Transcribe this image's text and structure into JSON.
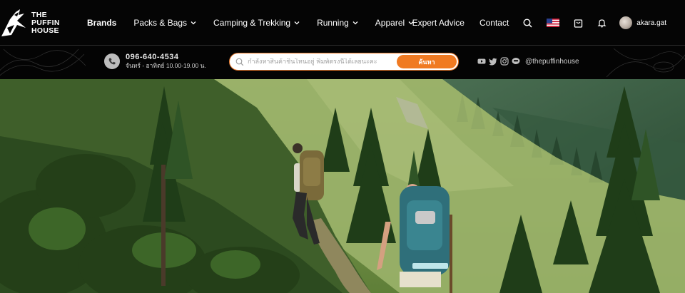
{
  "brand": {
    "line1": "THE",
    "line2": "PUFFIN",
    "line3": "HOUSE"
  },
  "nav": {
    "items": [
      {
        "label": "Brands",
        "dropdown": false
      },
      {
        "label": "Packs & Bags",
        "dropdown": true
      },
      {
        "label": "Camping & Trekking",
        "dropdown": true
      },
      {
        "label": "Running",
        "dropdown": true
      },
      {
        "label": "Apparel",
        "dropdown": true
      }
    ],
    "expert_advice": "Expert Advice",
    "contact": "Contact",
    "icons": [
      "search-icon",
      "us-flag-icon",
      "bag-icon",
      "bell-icon"
    ],
    "username": "akara.gat"
  },
  "contact_bar": {
    "phone": "096-640-4534",
    "hours": "จันทร์ - อาทิตย์ 10.00-19.00 น.",
    "search_placeholder": "กำลังหาสินค้าชิ้นไหนอยู่ พิมพ์ตรงนี้ได้เลยนะคะ",
    "search_button": "ค้นหา",
    "social_icons": [
      "youtube-icon",
      "twitter-icon",
      "instagram-icon",
      "line-icon"
    ],
    "handle": "@thepuffinhouse"
  },
  "colors": {
    "accent": "#f07a22",
    "nav_bg": "#050505"
  }
}
